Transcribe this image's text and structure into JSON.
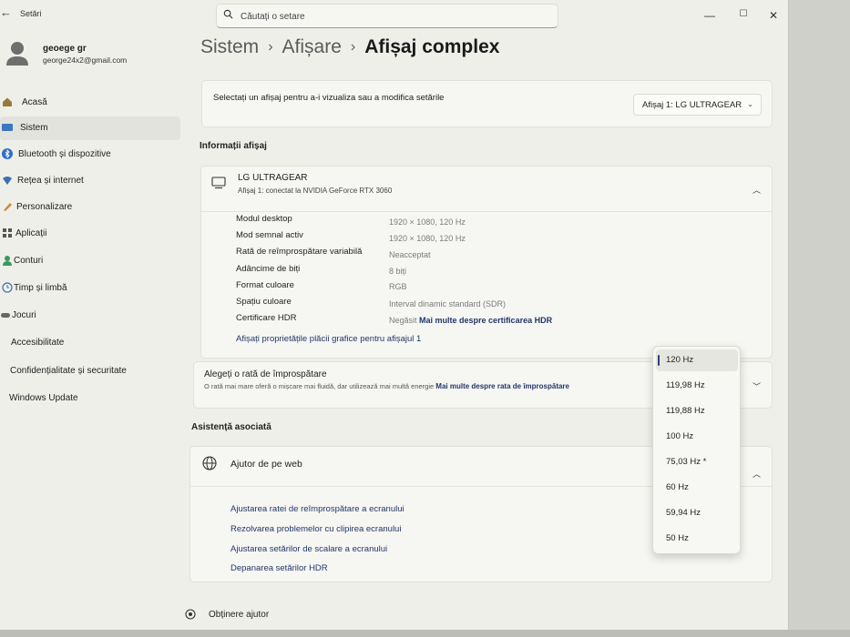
{
  "app": {
    "title": "Setări",
    "search_placeholder": "Căutați o setare",
    "back": "←",
    "minimize": "—",
    "maximize": "☐",
    "close": "✕"
  },
  "profile": {
    "name": "geoege gr",
    "email": "george24x2@gmail.com"
  },
  "sidebar": {
    "items": [
      {
        "label": "Acasă",
        "icon": "home-icon"
      },
      {
        "label": "Sistem",
        "icon": "system-icon"
      },
      {
        "label": "Bluetooth și dispozitive",
        "icon": "bluetooth-icon"
      },
      {
        "label": "Rețea și internet",
        "icon": "network-icon"
      },
      {
        "label": "Personalizare",
        "icon": "personalization-icon"
      },
      {
        "label": "Aplicații",
        "icon": "apps-icon"
      },
      {
        "label": "Conturi",
        "icon": "accounts-icon"
      },
      {
        "label": "Timp și limbă",
        "icon": "time-language-icon"
      },
      {
        "label": "Jocuri",
        "icon": "gaming-icon"
      },
      {
        "label": "Accesibilitate",
        "icon": "accessibility-icon"
      },
      {
        "label": "Confidențialitate și securitate",
        "icon": "privacy-icon"
      },
      {
        "label": "Windows Update",
        "icon": "windows-update-icon"
      }
    ],
    "active": "Sistem"
  },
  "breadcrumb": {
    "part1": "Sistem",
    "part2": "Afișare",
    "current": "Afișaj complex",
    "separator": "›"
  },
  "display_select": {
    "label": "Selectați un afișaj pentru a-i vizualiza sau a modifica setările",
    "value": "Afișaj 1: LG ULTRAGEAR"
  },
  "display_info": {
    "section_title": "Informații afișaj",
    "monitor_name": "LG ULTRAGEAR",
    "monitor_sub": "Afișaj 1: conectat la NVIDIA GeForce RTX 3060",
    "rows": [
      {
        "key": "Modul desktop",
        "value": "1920 × 1080, 120 Hz"
      },
      {
        "key": "Mod semnal activ",
        "value": "1920 × 1080, 120 Hz"
      },
      {
        "key": "Rată de reîmprospătare variabilă",
        "value": "Neacceptat"
      },
      {
        "key": "Adâncime de biți",
        "value": "8 biți"
      },
      {
        "key": "Format culoare",
        "value": "RGB"
      },
      {
        "key": "Spațiu culoare",
        "value": "Interval dinamic standard (SDR)"
      },
      {
        "key": "Certificare HDR",
        "value": "Negăsit",
        "link": "Mai multe despre certificarea HDR"
      }
    ],
    "gpu_link": "Afișați proprietățile plăcii grafice pentru afișajul 1"
  },
  "refresh_rate": {
    "title": "Alegeți o rată de împrospătare",
    "description": "O rată mai mare oferă o mișcare mai fluidă, dar utilizează mai multă energie",
    "link": "Mai multe despre rata de împrospătare",
    "options": [
      "120 Hz",
      "119,98 Hz",
      "119,88 Hz",
      "100 Hz",
      "75,03 Hz *",
      "60 Hz",
      "59,94 Hz",
      "50 Hz"
    ],
    "selected": "120 Hz"
  },
  "help": {
    "section_title": "Asistență asociată",
    "title": "Ajutor de pe web",
    "links": [
      "Ajustarea ratei de reîmprospătare a ecranului",
      "Rezolvarea problemelor cu clipirea ecranului",
      "Ajustarea setărilor de scalare a ecranului",
      "Depanarea setărilor HDR"
    ],
    "get_help": "Obținere ajutor"
  }
}
